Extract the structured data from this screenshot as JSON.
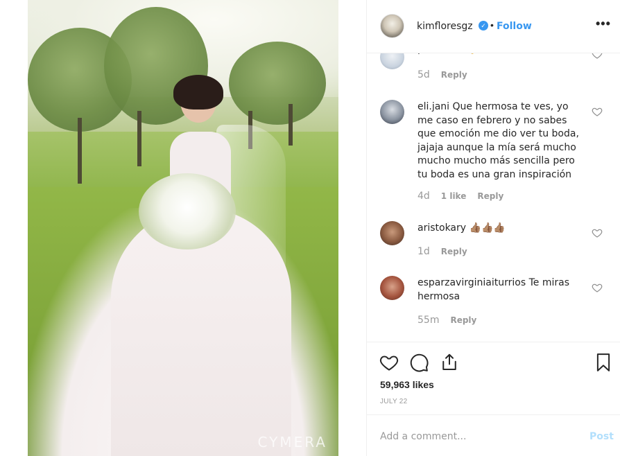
{
  "post": {
    "image_alt": "Bride in white lace wedding gown holding a bouquet on a grassy field",
    "watermark": "CYMERA"
  },
  "header": {
    "username": "kimfloresgz",
    "verified_icon": "check-badge-icon",
    "separator": "•",
    "follow_label": "Follow",
    "more_label": "•••"
  },
  "comments": [
    {
      "username": "pershoito",
      "text": "👌😊",
      "time": "5d",
      "likes": "",
      "reply": "Reply"
    },
    {
      "username": "eli.jani",
      "text": "Que hermosa te ves, yo me caso en febrero y no sabes que emoción me dio ver tu boda, jajaja aunque la mía será mucho mucho mucho más sencilla pero tu boda es una gran inspiración",
      "time": "4d",
      "likes": "1 like",
      "reply": "Reply"
    },
    {
      "username": "aristokary",
      "text": "👍🏽👍🏽👍🏽",
      "time": "1d",
      "likes": "",
      "reply": "Reply"
    },
    {
      "username": "esparzavirginiaiturrios",
      "text": "Te miras hermosa",
      "time": "55m",
      "likes": "",
      "reply": "Reply"
    }
  ],
  "actions": {
    "like_icon": "heart-icon",
    "comment_icon": "comment-icon",
    "share_icon": "share-icon",
    "save_icon": "bookmark-icon",
    "likes_count": "59,963 likes",
    "date": "JULY 22"
  },
  "add_comment": {
    "placeholder": "Add a comment...",
    "post_label": "Post"
  },
  "colors": {
    "accent": "#3897f0",
    "muted": "#999999",
    "post_disabled": "#b2dffc"
  }
}
